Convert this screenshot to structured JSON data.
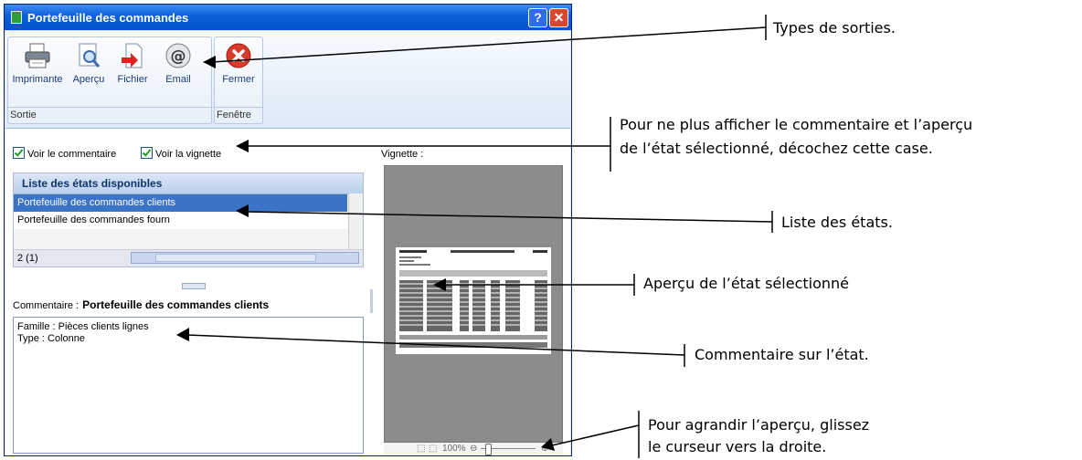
{
  "window": {
    "title": "Portefeuille des commandes",
    "help_glyph": "?",
    "close_glyph": "✕"
  },
  "ribbon": {
    "groups": [
      {
        "label": "Sortie",
        "buttons": [
          {
            "label": "Imprimante",
            "icon": "printer-icon"
          },
          {
            "label": "Aperçu",
            "icon": "preview-icon"
          },
          {
            "label": "Fichier",
            "icon": "file-icon"
          },
          {
            "label": "Email",
            "icon": "email-icon"
          }
        ]
      },
      {
        "label": "Fenêtre",
        "buttons": [
          {
            "label": "Fermer",
            "icon": "close-icon"
          }
        ]
      }
    ]
  },
  "options": {
    "voir_commentaire": "Voir le commentaire",
    "voir_vignette": "Voir la vignette",
    "commentaire_checked": true,
    "vignette_checked": true
  },
  "list": {
    "header": "Liste des états disponibles",
    "rows": [
      "Portefeuille des commandes clients",
      "Portefeuille des commandes fourn"
    ],
    "selected_index": 0,
    "count": "2 (1)"
  },
  "comment": {
    "label": "Commentaire :",
    "title": "Portefeuille des commandes clients",
    "lines": [
      "Famille : Pièces clients lignes",
      "Type : Colonne"
    ]
  },
  "vignette": {
    "label": "Vignette :",
    "zoom": "100%"
  },
  "annotations": [
    {
      "lines": [
        "Types de sorties."
      ]
    },
    {
      "lines": [
        "Pour ne plus afficher le commentaire et l’aperçu",
        "de l’état sélectionné, décochez cette case."
      ]
    },
    {
      "lines": [
        "Liste des états."
      ]
    },
    {
      "lines": [
        "Aperçu de l’état sélectionné"
      ]
    },
    {
      "lines": [
        "Commentaire sur l’état."
      ]
    },
    {
      "lines": [
        "Pour agrandir l’aperçu, glissez",
        "le curseur vers la droite."
      ]
    }
  ],
  "colors": {
    "titlebar": "#0a5fd8",
    "selection": "#3b73c6",
    "close_button": "#d9482e"
  }
}
